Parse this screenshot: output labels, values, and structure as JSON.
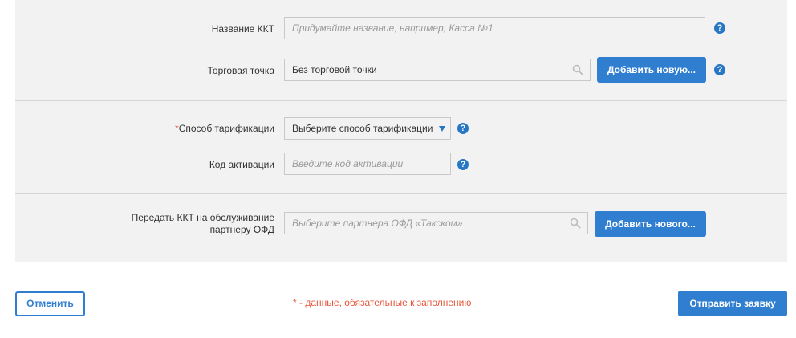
{
  "form": {
    "kkt_name": {
      "label": "Название ККТ",
      "placeholder": "Придумайте название, например, Касса №1"
    },
    "trade_point": {
      "label": "Торговая точка",
      "value": "Без торговой точки",
      "add_button": "Добавить новую..."
    },
    "tariff": {
      "required_mark": "*",
      "label": "Способ тарификации",
      "value": "Выберите способ тарификации"
    },
    "activation_code": {
      "label": "Код активации",
      "placeholder": "Введите код активации"
    },
    "partner": {
      "label_line1": "Передать ККТ на обслуживание",
      "label_line2": "партнеру ОФД",
      "placeholder": "Выберите партнера ОФД «Такском»",
      "add_button": "Добавить нового..."
    },
    "help_glyph": "?"
  },
  "footer": {
    "cancel_button": "Отменить",
    "required_note": "* - данные, обязательные к заполнению",
    "submit_button": "Отправить заявку"
  },
  "colors": {
    "accent": "#2f7ed0",
    "required": "#e8553a",
    "panel": "#f2f2f2"
  }
}
